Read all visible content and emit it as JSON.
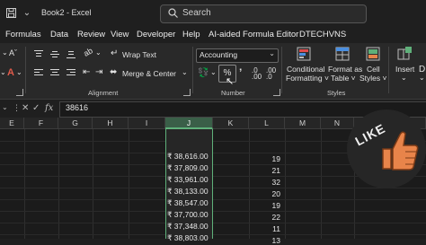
{
  "window": {
    "title": "Book2 - Excel",
    "search_placeholder": "Search"
  },
  "menu": [
    "Formulas",
    "Data",
    "Review",
    "View",
    "Developer",
    "Help",
    "AI-aided Formula Editor",
    "DTECHVNS"
  ],
  "ribbon": {
    "wrap_text": "Wrap Text",
    "merge_center": "Merge & Center",
    "alignment_label": "Alignment",
    "number_format": "Accounting",
    "number_label": "Number",
    "conditional": [
      "Conditional",
      "Formatting ˅"
    ],
    "format_as": [
      "Format as",
      "Table ˅"
    ],
    "cell": [
      "Cell",
      "Styles ˅"
    ],
    "styles_label": "Styles",
    "insert": "Insert"
  },
  "formula_bar": {
    "value": "38616"
  },
  "columns": [
    "E",
    "F",
    "G",
    "H",
    "I",
    "J",
    "K",
    "L",
    "M",
    "N"
  ],
  "selected_column": "J",
  "column_j": [
    "₹ 38,616.00",
    "₹ 37,809.00",
    "₹ 33,961.00",
    "₹ 38,133.00",
    "₹ 38,547.00",
    "₹ 37,700.00",
    "₹ 37,348.00",
    "₹ 38,803.00"
  ],
  "column_l": [
    "19",
    "21",
    "32",
    "20",
    "19",
    "22",
    "11",
    "13"
  ],
  "sticker": {
    "text": "LIKE"
  },
  "colors": {
    "accent_green": "#5fb07a",
    "thumb_orange": "#e8844a"
  }
}
